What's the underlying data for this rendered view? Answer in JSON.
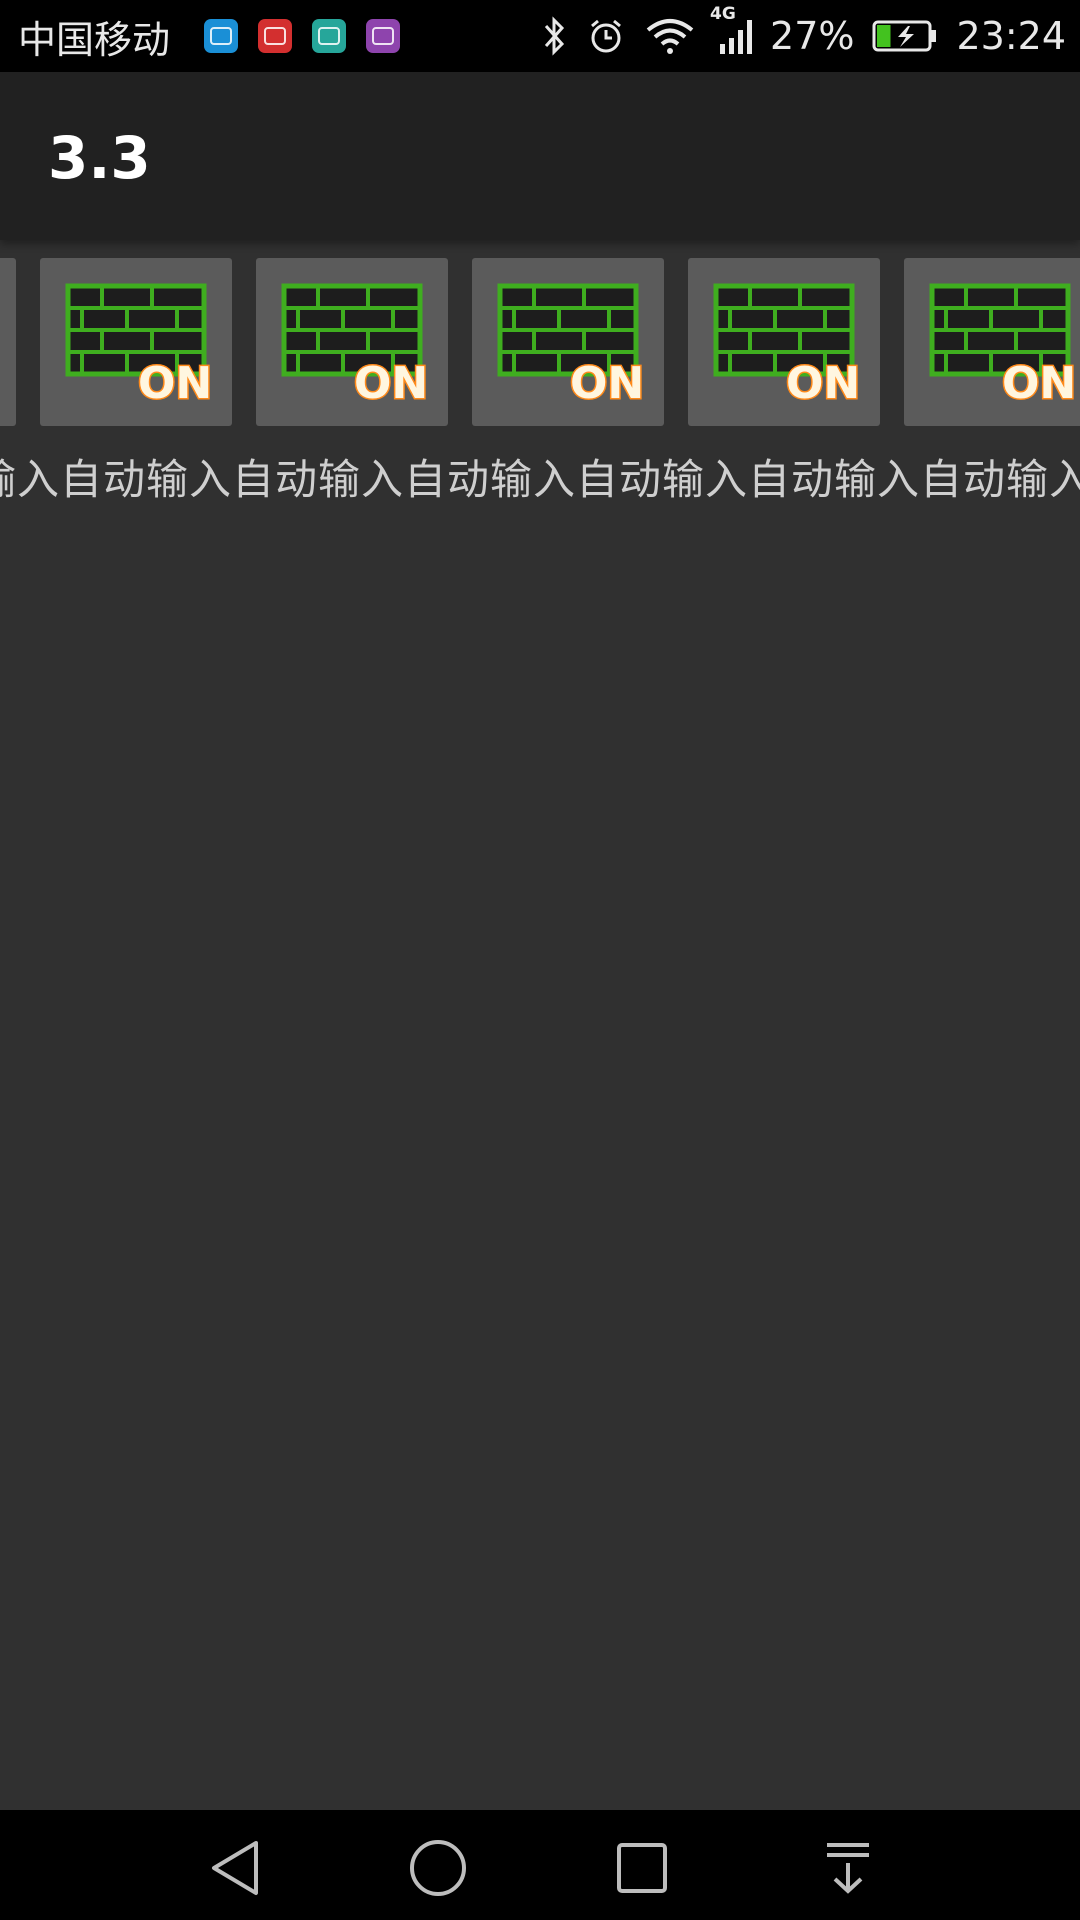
{
  "status_bar": {
    "carrier": "中国移动",
    "network_type": "4G",
    "battery_percent": "27%",
    "battery_level": 0.27,
    "time": "23:24",
    "notification_icons": [
      {
        "name": "weibo-app-icon",
        "color": "#1a8fd6"
      },
      {
        "name": "huawei-app-icon",
        "color": "#d32f2f"
      },
      {
        "name": "android-app-icon",
        "color": "#26a69a"
      },
      {
        "name": "gallery-app-icon",
        "color": "#8e44ad"
      }
    ]
  },
  "app_bar": {
    "title": "3.3"
  },
  "tiles": {
    "badge_text": "ON",
    "label": "自动输入",
    "label_row": "输入自动输入自动输入自动输入自动输入自动输入自动输入自动输入自",
    "count_visible": 6
  },
  "colors": {
    "background": "#303030",
    "app_bar": "#212121",
    "tile": "#5b5b5b",
    "brick_green": "#3fae1f",
    "on_glow": "#ff8a1a"
  }
}
